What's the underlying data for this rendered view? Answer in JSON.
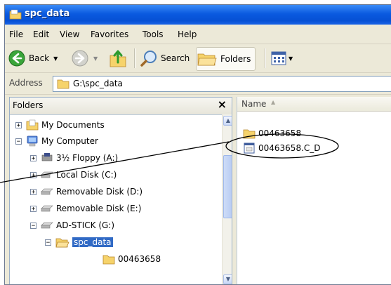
{
  "window": {
    "title": "spc_data"
  },
  "menu": [
    "File",
    "Edit",
    "View",
    "Favorites",
    "Tools",
    "Help"
  ],
  "toolbar": {
    "back_label": "Back",
    "search_label": "Search",
    "folders_label": "Folders"
  },
  "address": {
    "label": "Address",
    "value": "G:\\spc_data"
  },
  "folders_panel": {
    "title": "Folders",
    "close_glyph": "×",
    "items": [
      {
        "label": "My Documents",
        "expander": "+"
      },
      {
        "label": "My Computer",
        "expander": "−"
      },
      {
        "label": "3½ Floppy (A:)",
        "expander": "+"
      },
      {
        "label": "Local Disk (C:)",
        "expander": "+"
      },
      {
        "label": "Removable Disk (D:)",
        "expander": "+"
      },
      {
        "label": "Removable Disk (E:)",
        "expander": "+"
      },
      {
        "label": "AD-STICK (G:)",
        "expander": "−"
      },
      {
        "label": "spc_data",
        "expander": "−",
        "selected": true
      },
      {
        "label": "00463658",
        "expander": ""
      }
    ]
  },
  "content": {
    "column_name": "Name",
    "files": [
      {
        "name": "00463658",
        "type": "folder"
      },
      {
        "name": "00463658.C_D",
        "type": "file"
      }
    ]
  },
  "colors": {
    "titlebar": "#0a5ae0",
    "selection": "#316ac5",
    "window_bg": "#ece9d8",
    "folder_yellow": "#f6d36b"
  }
}
